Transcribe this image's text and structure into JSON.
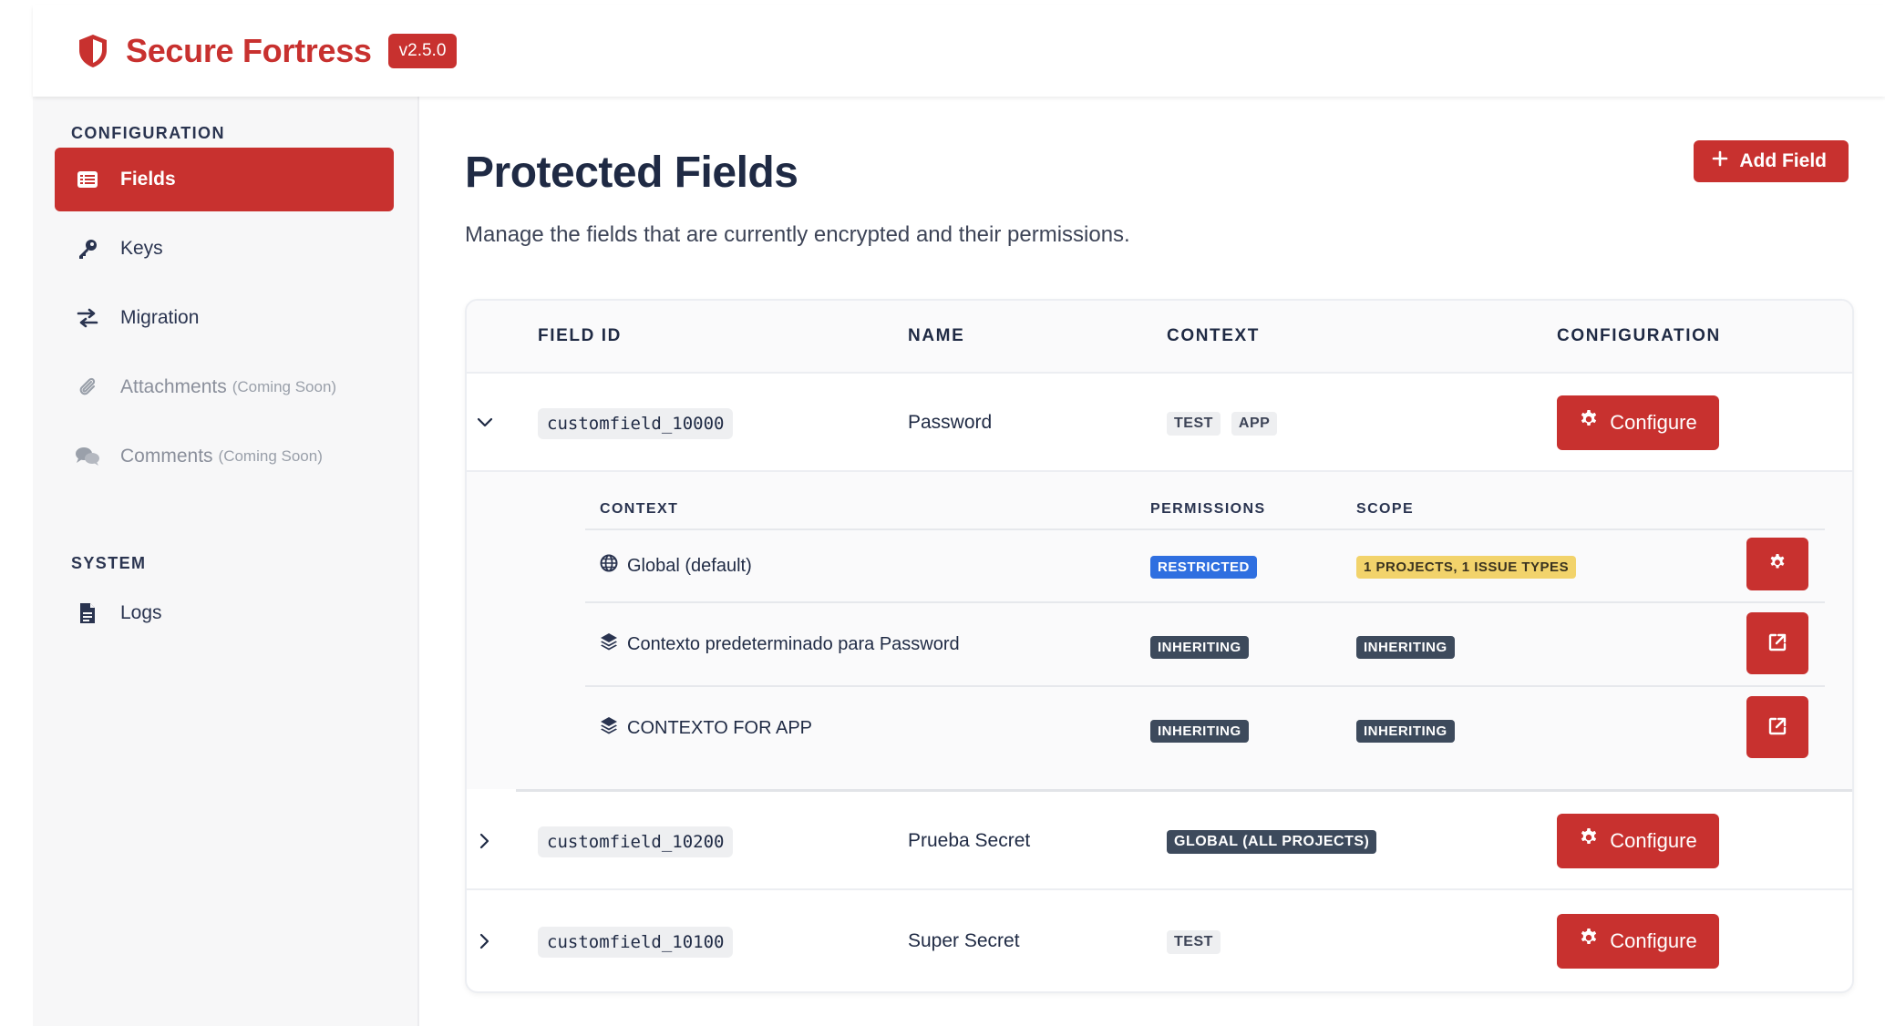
{
  "brand": {
    "name": "Secure Fortress",
    "version": "v2.5.0",
    "accent": "#c8312f"
  },
  "sidebar": {
    "configuration_title": "CONFIGURATION",
    "system_title": "SYSTEM",
    "items": [
      {
        "label": "Fields",
        "icon": "list-icon",
        "active": true
      },
      {
        "label": "Keys",
        "icon": "key-icon"
      },
      {
        "label": "Migration",
        "icon": "swap-icon"
      },
      {
        "label": "Attachments",
        "icon": "paperclip-icon",
        "soon": "(Coming Soon)"
      },
      {
        "label": "Comments",
        "icon": "comments-icon",
        "soon": "(Coming Soon)"
      }
    ],
    "system_items": [
      {
        "label": "Logs",
        "icon": "file-icon"
      }
    ]
  },
  "main": {
    "title": "Protected Fields",
    "subtitle": "Manage the fields that are currently encrypted and their permissions.",
    "add_button": "Add Field",
    "columns": [
      "FIELD ID",
      "NAME",
      "CONTEXT",
      "CONFIGURATION"
    ],
    "configure_label": "Configure",
    "rows": [
      {
        "field_id": "customfield_10000",
        "name": "Password",
        "tags": [
          "TEST",
          "APP"
        ],
        "expanded": true
      },
      {
        "field_id": "customfield_10200",
        "name": "Prueba Secret",
        "tags": [
          "GLOBAL (ALL PROJECTS)"
        ],
        "expanded": false
      },
      {
        "field_id": "customfield_10100",
        "name": "Super Secret",
        "tags": [
          "TEST"
        ],
        "expanded": false
      }
    ],
    "sub_columns": [
      "CONTEXT",
      "PERMISSIONS",
      "SCOPE"
    ],
    "contexts": [
      {
        "name": "Global (default)",
        "icon": "globe-icon",
        "permissions": "RESTRICTED",
        "scope": "1 PROJECTS, 1 ISSUE TYPES",
        "action": "gear-icon"
      },
      {
        "name": "Contexto predeterminado para Password",
        "icon": "layers-icon",
        "permissions": "INHERITING",
        "scope": "INHERITING",
        "action": "external-link-icon"
      },
      {
        "name": "CONTEXTO FOR APP",
        "icon": "layers-icon",
        "permissions": "INHERITING",
        "scope": "INHERITING",
        "action": "external-link-icon"
      }
    ]
  }
}
